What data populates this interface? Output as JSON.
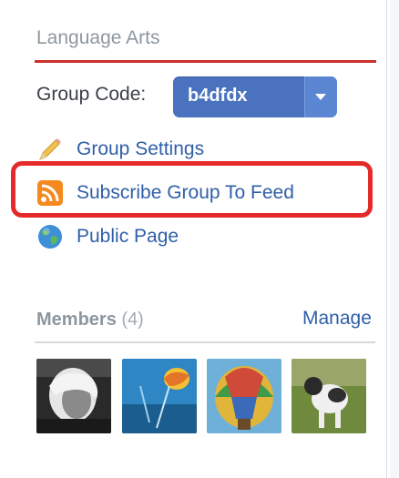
{
  "section": {
    "title": "Language Arts"
  },
  "group_code": {
    "label": "Group Code:",
    "value": "b4dfdx"
  },
  "links": [
    {
      "label": "Group Settings",
      "icon": "pencil-icon"
    },
    {
      "label": "Subscribe Group To Feed",
      "icon": "rss-icon"
    },
    {
      "label": "Public Page",
      "icon": "globe-icon"
    }
  ],
  "members": {
    "label": "Members",
    "count": "(4)",
    "manage_label": "Manage"
  },
  "colors": {
    "accent_rule": "#c9302c",
    "link": "#2f5fa8",
    "select_bg": "#4a72be",
    "highlight": "#e52a2a"
  }
}
